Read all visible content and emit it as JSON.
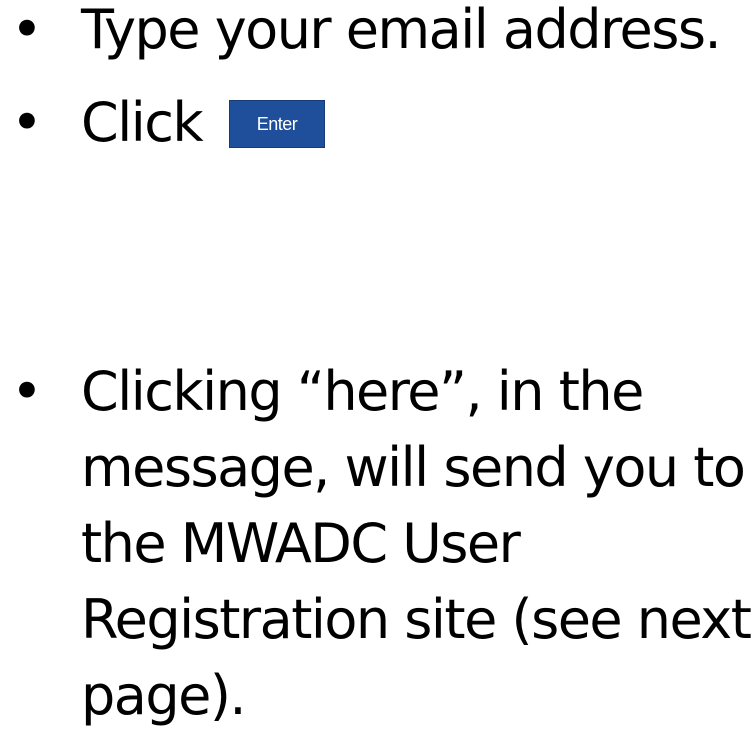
{
  "bullets": {
    "glyph": "•",
    "item1": "Type your email address.",
    "item2_prefix": "Click",
    "item3": "Clicking “here”, in the message, will send you to the MWADC User Registration site (see next page)."
  },
  "enter_button": {
    "label": "Enter",
    "color": "#1f4e9a"
  }
}
